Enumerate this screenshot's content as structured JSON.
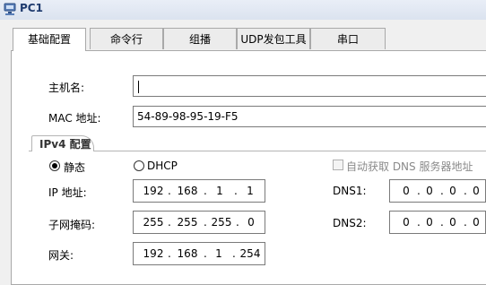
{
  "window": {
    "title": "PC1"
  },
  "tabs": [
    {
      "label": "基础配置"
    },
    {
      "label": "命令行"
    },
    {
      "label": "组播"
    },
    {
      "label": "UDP发包工具"
    },
    {
      "label": "串口"
    }
  ],
  "basic": {
    "hostname_label": "主机名:",
    "hostname_value": "",
    "mac_label": "MAC 地址:",
    "mac_value": "54-89-98-95-19-F5"
  },
  "ipv4": {
    "group_label": "IPv4 配置",
    "static_label": "静态",
    "dhcp_label": "DHCP",
    "auto_dns_label": "自动获取 DNS 服务器地址",
    "ip_label": "IP 地址:",
    "ip": [
      "192",
      "168",
      "1",
      "1"
    ],
    "mask_label": "子网掩码:",
    "mask": [
      "255",
      "255",
      "255",
      "0"
    ],
    "gateway_label": "网关:",
    "gateway": [
      "192",
      "168",
      "1",
      "254"
    ],
    "dns1_label": "DNS1:",
    "dns1": [
      "0",
      "0",
      "0",
      "0"
    ],
    "dns2_label": "DNS2:",
    "dns2": [
      "0",
      "0",
      "0",
      "0"
    ]
  }
}
